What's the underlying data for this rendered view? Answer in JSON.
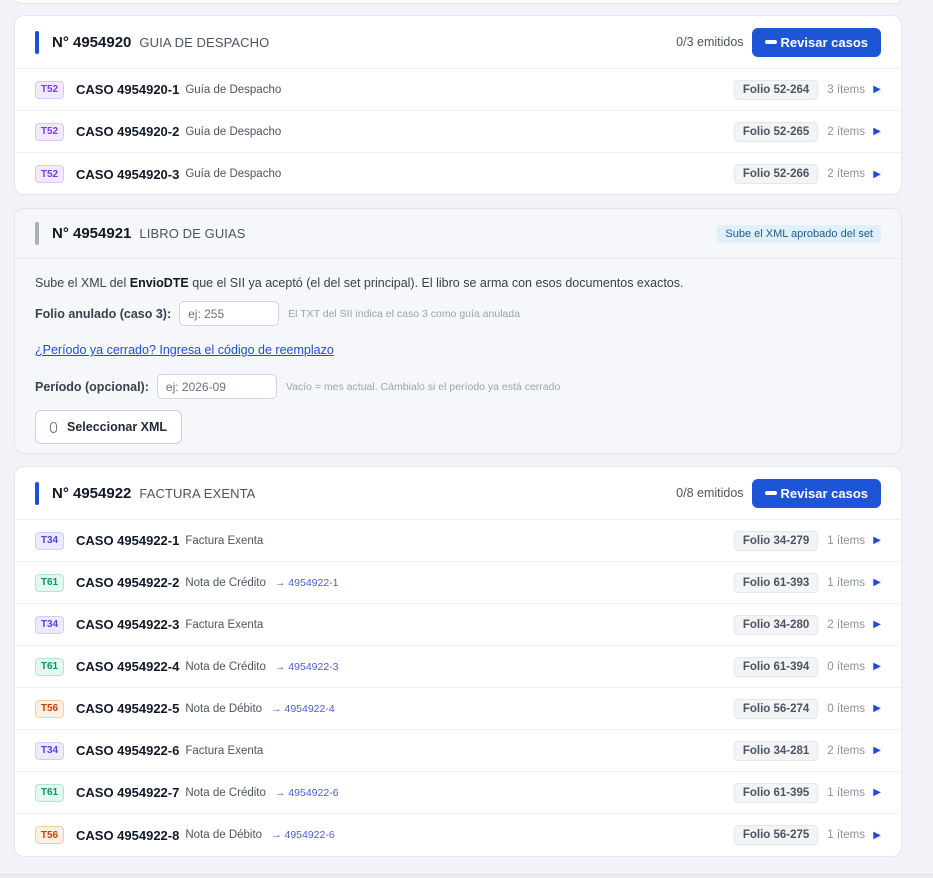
{
  "sections": [
    {
      "number": "N° 4954920",
      "kind": "GUIA DE DESPACHO",
      "emitted": "0/3 emitidos",
      "review_label": "Revisar casos",
      "rows": [
        {
          "tag": "T52",
          "case": "CASO 4954920-1",
          "desc": "Guía de Despacho",
          "ref": "",
          "folio": "Folio 52-264",
          "items": "3 ítems"
        },
        {
          "tag": "T52",
          "case": "CASO 4954920-2",
          "desc": "Guía de Despacho",
          "ref": "",
          "folio": "Folio 52-265",
          "items": "2 ítems"
        },
        {
          "tag": "T52",
          "case": "CASO 4954920-3",
          "desc": "Guía de Despacho",
          "ref": "",
          "folio": "Folio 52-266",
          "items": "2 ítems"
        }
      ]
    },
    {
      "number": "N° 4954921",
      "kind": "LIBRO DE GUIAS",
      "badge": "Sube el XML aprobado del set",
      "intro_prefix": "Sube el XML del ",
      "intro_bold": "EnvioDTE",
      "intro_suffix": " que el SII ya aceptó (el del set principal). El libro se arma con esos documentos exactos.",
      "folio_label": "Folio anulado (caso 3):",
      "folio_placeholder": "ej: 255",
      "folio_hint": "El TXT del SII indica el caso 3 como guía anulada",
      "link": "¿Período ya cerrado? Ingresa el código de reemplazo",
      "period_label": "Período (opcional):",
      "period_placeholder": "ej: 2026-09",
      "period_hint": "Vacío = mes actual. Cámbialo si el período ya está cerrado",
      "select_label": "Seleccionar XML"
    },
    {
      "number": "N° 4954922",
      "kind": "FACTURA EXENTA",
      "emitted": "0/8 emitidos",
      "review_label": "Revisar casos",
      "rows": [
        {
          "tag": "T34",
          "case": "CASO 4954922-1",
          "desc": "Factura Exenta",
          "ref": "",
          "folio": "Folio 34-279",
          "items": "1 ítems"
        },
        {
          "tag": "T61",
          "case": "CASO 4954922-2",
          "desc": "Nota de Crédito",
          "ref": "→ 4954922-1",
          "folio": "Folio 61-393",
          "items": "1 ítems"
        },
        {
          "tag": "T34",
          "case": "CASO 4954922-3",
          "desc": "Factura Exenta",
          "ref": "",
          "folio": "Folio 34-280",
          "items": "2 ítems"
        },
        {
          "tag": "T61",
          "case": "CASO 4954922-4",
          "desc": "Nota de Crédito",
          "ref": "→ 4954922-3",
          "folio": "Folio 61-394",
          "items": "0 ítems"
        },
        {
          "tag": "T56",
          "case": "CASO 4954922-5",
          "desc": "Nota de Débito",
          "ref": "→ 4954922-4",
          "folio": "Folio 56-274",
          "items": "0 ítems"
        },
        {
          "tag": "T34",
          "case": "CASO 4954922-6",
          "desc": "Factura Exenta",
          "ref": "",
          "folio": "Folio 34-281",
          "items": "2 ítems"
        },
        {
          "tag": "T61",
          "case": "CASO 4954922-7",
          "desc": "Nota de Crédito",
          "ref": "→ 4954922-6",
          "folio": "Folio 61-395",
          "items": "1 ítems"
        },
        {
          "tag": "T56",
          "case": "CASO 4954922-8",
          "desc": "Nota de Débito",
          "ref": "→ 4954922-6",
          "folio": "Folio 56-275",
          "items": "1 ítems"
        }
      ]
    }
  ],
  "icons": {
    "row_arrow": "play-arrow-icon",
    "review": "dash-icon",
    "attach": "paperclip-icon"
  }
}
